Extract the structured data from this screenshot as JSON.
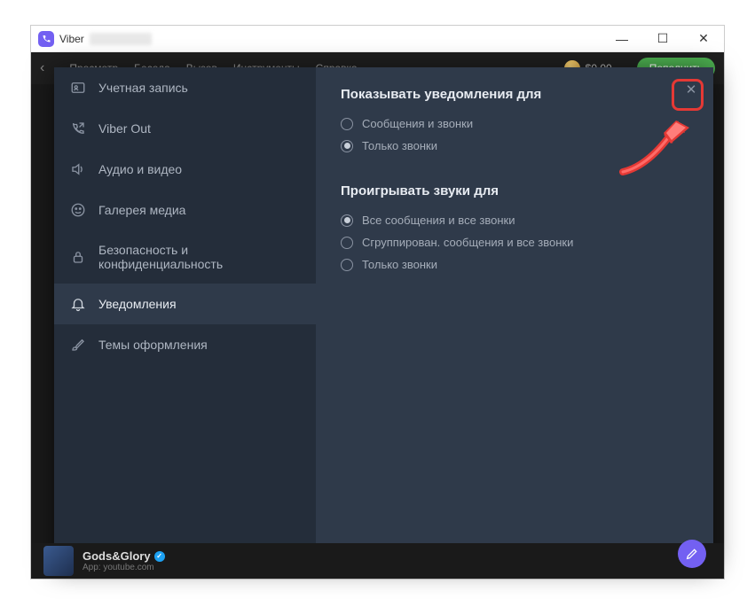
{
  "window": {
    "title": "Viber"
  },
  "topmenu": {
    "items": [
      "Просмотр",
      "Беседа",
      "Вызов",
      "Инструменты",
      "Справка"
    ],
    "balance": "$0.00",
    "topup": "Пополнить"
  },
  "sidebar": {
    "items": [
      {
        "label": "Учетная запись",
        "icon": "id-card"
      },
      {
        "label": "Viber Out",
        "icon": "phone-out"
      },
      {
        "label": "Аудио и видео",
        "icon": "speaker"
      },
      {
        "label": "Галерея медиа",
        "icon": "gallery"
      },
      {
        "label": "Безопасность и конфиденциальность",
        "icon": "lock"
      },
      {
        "label": "Уведомления",
        "icon": "bell"
      },
      {
        "label": "Темы оформления",
        "icon": "brush"
      }
    ],
    "active_index": 5
  },
  "content": {
    "section1": {
      "title": "Показывать уведомления для",
      "options": [
        {
          "label": "Сообщения и звонки",
          "selected": false
        },
        {
          "label": "Только звонки",
          "selected": true
        }
      ]
    },
    "section2": {
      "title": "Проигрывать звуки для",
      "options": [
        {
          "label": "Все сообщения и все звонки",
          "selected": true
        },
        {
          "label": "Сгруппирован. сообщения и все звонки",
          "selected": false
        },
        {
          "label": "Только звонки",
          "selected": false
        }
      ]
    }
  },
  "bottom": {
    "chat_name": "Gods&Glory",
    "chat_sub": "App: youtube.com"
  }
}
